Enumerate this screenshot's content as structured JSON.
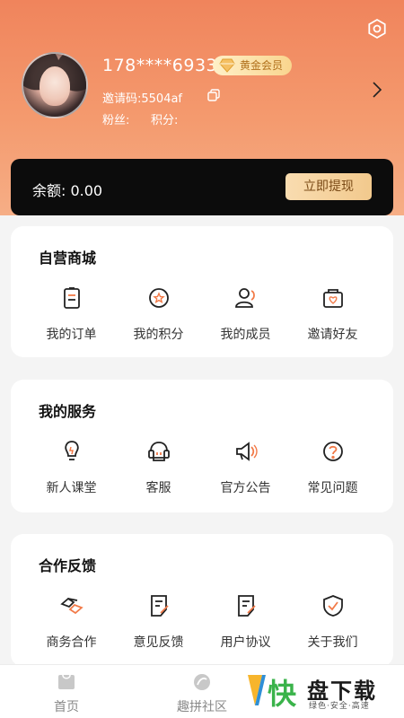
{
  "profile": {
    "phone": "178****6933",
    "vip_label": "黄金会员",
    "invite_code": "邀请码:5504af",
    "fans_label": "粉丝:",
    "points_label": "积分:"
  },
  "balance": {
    "text": "余额: 0.00",
    "withdraw_label": "立即提现"
  },
  "sections": [
    {
      "title": "自营商城",
      "items": [
        {
          "label": "我的订单",
          "icon": "order-icon"
        },
        {
          "label": "我的积分",
          "icon": "points-icon"
        },
        {
          "label": "我的成员",
          "icon": "members-icon"
        },
        {
          "label": "邀请好友",
          "icon": "invite-friends-icon"
        }
      ]
    },
    {
      "title": "我的服务",
      "items": [
        {
          "label": "新人课堂",
          "icon": "lightbulb-icon"
        },
        {
          "label": "客服",
          "icon": "customer-service-icon"
        },
        {
          "label": "官方公告",
          "icon": "megaphone-icon"
        },
        {
          "label": "常见问题",
          "icon": "question-icon"
        }
      ]
    },
    {
      "title": "合作反馈",
      "items": [
        {
          "label": "商务合作",
          "icon": "handshake-icon"
        },
        {
          "label": "意见反馈",
          "icon": "feedback-icon"
        },
        {
          "label": "用户协议",
          "icon": "agreement-icon"
        },
        {
          "label": "关于我们",
          "icon": "shield-check-icon"
        }
      ]
    }
  ],
  "tabbar": [
    {
      "label": "首页",
      "icon": "home-icon"
    },
    {
      "label": "趣拼社区",
      "icon": "community-icon"
    }
  ],
  "watermark": {
    "logo_text": "快",
    "main": "盘下载",
    "sub": "绿色·安全·高速"
  },
  "colors": {
    "header_top": "#f0845c",
    "accent_orange": "#f27a48",
    "balance_bg": "#0c0c0c",
    "vip_text": "#b0701c"
  }
}
